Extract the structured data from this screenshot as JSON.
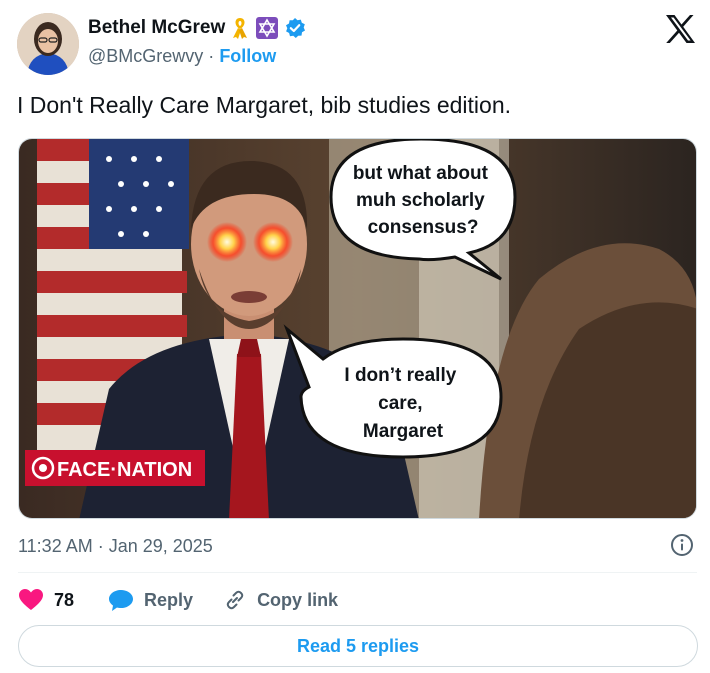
{
  "author": {
    "name": "Bethel McGrew",
    "handle": "@BMcGrewvy",
    "separator": "·",
    "follow_label": "Follow"
  },
  "tweet": {
    "text": "I Don't Really Care Margaret, bib studies edition.",
    "timestamp": "11:32 AM · Jan 29, 2025"
  },
  "media": {
    "bubble_top": [
      "but what about",
      "muh scholarly",
      "consensus?"
    ],
    "bubble_bottom": [
      "I don’t really",
      "care,",
      "Margaret"
    ],
    "network_logo": "FACE THE NATION"
  },
  "actions": {
    "like_count": "78",
    "reply_label": "Reply",
    "copy_label": "Copy link"
  },
  "footer": {
    "read_replies_label": "Read 5 replies"
  },
  "colors": {
    "accent": "#1d9bf0",
    "like": "#f91880",
    "text": "#0f1419",
    "muted": "#536471"
  }
}
